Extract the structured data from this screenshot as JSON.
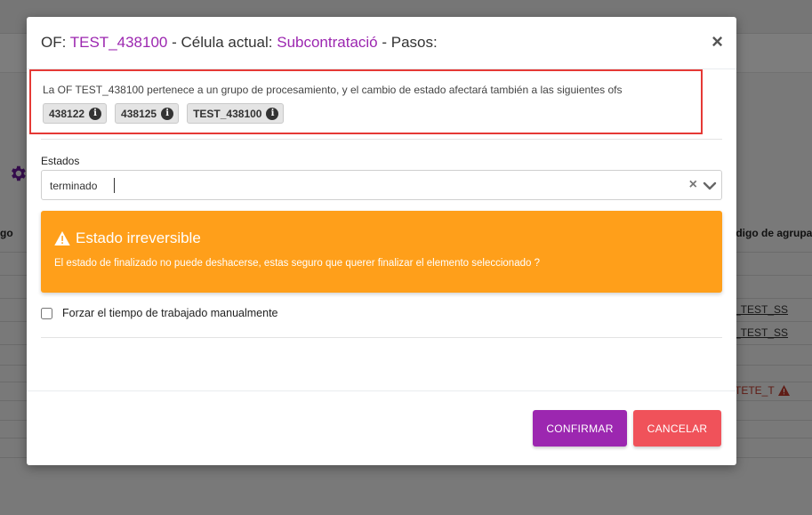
{
  "background": {
    "left_header": "go",
    "right_header": "ódigo de agrupa",
    "links": [
      "_TEST_SS",
      "_TEST_SS"
    ],
    "error_text": "TETE_T"
  },
  "modal": {
    "title": {
      "prefix": "OF: ",
      "of_code": "TEST_438100",
      "cell_label": " - Célula actual: ",
      "cell_value": "Subcontratació",
      "steps_label": " - Pasos:"
    },
    "close_symbol": "×",
    "notice": {
      "text": "La OF TEST_438100 pertenece a un grupo de procesamiento, y el cambio de estado afectará también a las siguientes ofs",
      "chips": [
        {
          "label": "438122"
        },
        {
          "label": "438125"
        },
        {
          "label": "TEST_438100"
        }
      ]
    },
    "estados": {
      "label": "Estados",
      "value": "terminado",
      "clear_symbol": "×"
    },
    "warning": {
      "title": "Estado irreversible",
      "text": "El estado de finalizado no puede deshacerse, estas seguro que querer finalizar el elemento seleccionado ?"
    },
    "force_manual": {
      "label": "Forzar el tiempo de trabajado manualmente",
      "checked": false
    },
    "buttons": {
      "confirm": "CONFIRMAR",
      "cancel": "CANCELAR"
    }
  },
  "colors": {
    "accent": "#9c27b0",
    "warning": "#ff9f1a",
    "cancel": "#f0525a",
    "highlight_border": "#e53935"
  }
}
